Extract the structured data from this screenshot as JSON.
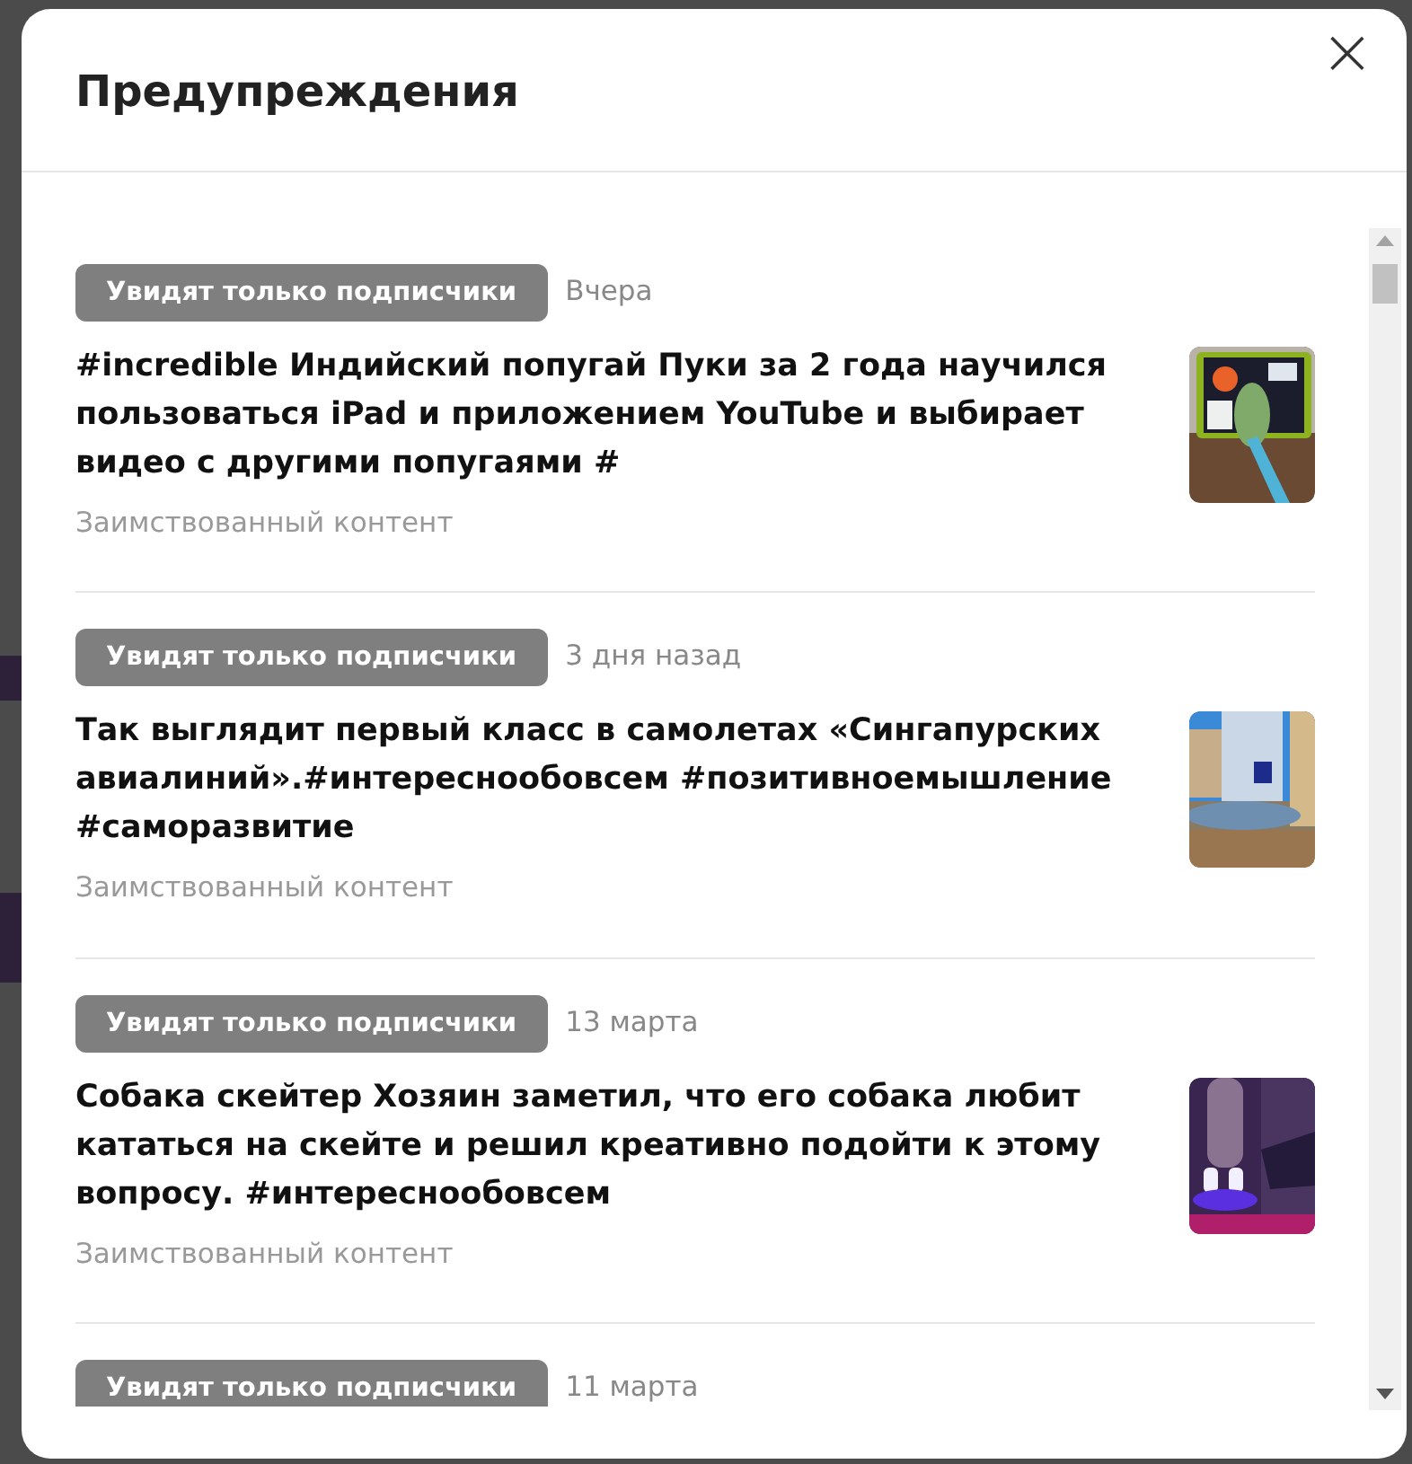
{
  "modal": {
    "title": "Предупреждения",
    "close": "×"
  },
  "warnings": [
    {
      "badge": "Увидят только подписчики",
      "date": "Вчера",
      "title": "#incredible Индийский попугай Пуки за 2 года научился пользоваться iPad и приложением YouTube и выбирает видео с другими попугаями #",
      "reason": "Заимствованный контент"
    },
    {
      "badge": "Увидят только подписчики",
      "date": "3 дня назад",
      "title": "Так выглядит первый класс в самолетах «Сингапурских авиалиний».#интереснообовсем #позитивноемышление #саморазвитие",
      "reason": "Заимствованный контент"
    },
    {
      "badge": "Увидят только подписчики",
      "date": "13 марта",
      "title": "Собака скейтер Хозяин заметил, что его собака любит кататься на скейте и решил креативно подойти к этому вопросу. #интереснообовсем",
      "reason": "Заимствованный контент"
    },
    {
      "badge": "Увидят только подписчики",
      "date": "11 марта"
    }
  ]
}
